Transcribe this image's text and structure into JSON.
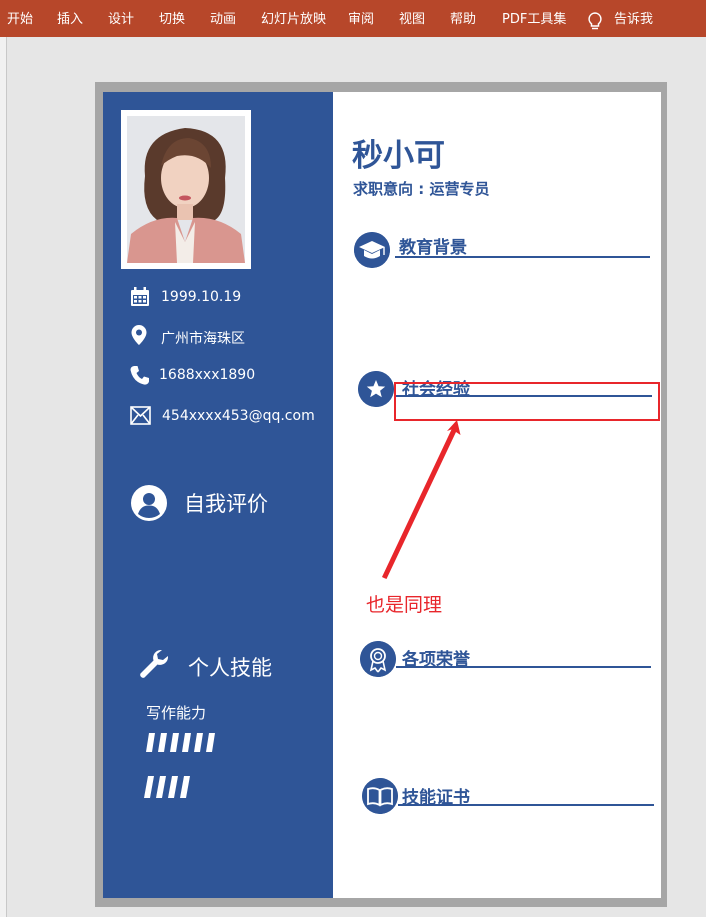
{
  "ribbon": {
    "tabs": [
      "开始",
      "插入",
      "设计",
      "切换",
      "动画",
      "幻灯片放映",
      "审阅",
      "视图",
      "帮助",
      "PDF工具集"
    ],
    "tell_me": "告诉我"
  },
  "resume": {
    "name": "秒小可",
    "objective": "求职意向 : 运营专员",
    "birthday": "1999.10.19",
    "location": "广州市海珠区",
    "phone": "1688xxx1890",
    "email": "454xxxx453@qq.com",
    "self_eval_title": "自我评价",
    "skills_title": "个人技能",
    "skill_name": "写作能力",
    "sections": [
      "教育背景",
      "社会经验",
      "各项荣誉",
      "技能证书"
    ]
  },
  "annotation": {
    "note": "也是同理"
  },
  "colors": {
    "ribbon": "#b7472a",
    "theme_blue": "#2f5597",
    "annotation_red": "#e8262b"
  }
}
